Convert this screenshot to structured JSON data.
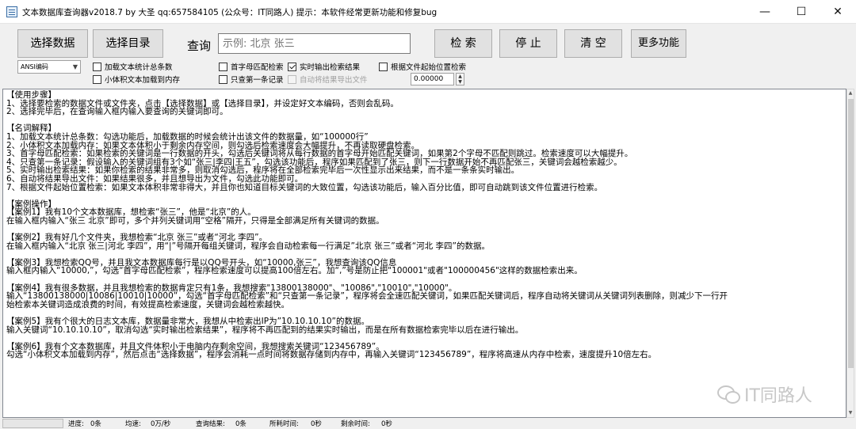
{
  "window": {
    "title": "文本数据库查询器v2018.7   by 大圣  qq:657584105  (公众号：IT同路人)  提示：本软件经常更新功能和修复bug",
    "minimize": "—",
    "maximize": "☐",
    "close": "✕"
  },
  "toolbar": {
    "select_data": "选择数据",
    "select_dir": "选择目录",
    "search_label": "查询",
    "search_placeholder": "示例: 北京 张三",
    "search_btn": "检 索",
    "stop_btn": "停 止",
    "clear_btn": "清 空",
    "more_btn": "更多功能"
  },
  "options": {
    "encoding": "ANSI编码",
    "load_count": "加载文本统计总条数",
    "small_to_memory": "小体积文本加载到内存",
    "first_letter": "首字母匹配检索",
    "realtime_output": "实时输出检索结果",
    "only_first": "只查第一条记录",
    "auto_export": "自动将结果导出文件",
    "by_position": "根据文件起始位置检索",
    "position_value": "0.00000"
  },
  "help_lines": [
    "【使用步骤】",
    "1、选择要检索的数据文件或文件夹，点击【选择数据】或【选择目录】，并设定好文本编码，否则会乱码。",
    "2、选择完毕后，在查询输入框内输入要查询的关键词即可。",
    "",
    "【名词解释】",
    "1、加载文本统计总条数：勾选功能后，加载数据的时候会统计出该文件的数据量，如“100000行”",
    "2、小体积文本加载内存：如果文本体积小于剩余内存空间，则勾选后检索速度会大幅提升，不再读取硬盘检索。",
    "3、首字母匹配检索：如果检索的关键词是一行数据的开头，勾选后关键词将从每行数据的首字母开始匹配关键词，如果第2个字母不匹配则跳过。检索速度可以大幅提升。",
    "4、只查第一条记录：假设输入的关键词组有3个如“张三|李四|王五”，勾选该功能后，程序如果匹配到了张三，则下一行数据开始不再匹配张三，关键词会越检索越少。",
    "5、实时输出检索结果：如果你检索的结果非常多，则取消勾选后，程序将在全部检索完毕后一次性显示出来结果，而不是一条条实时输出。",
    "6、自动将结果导出文件：如果结果很多，并且想导出为文件，勾选此功能即可。",
    "7、根据文件起始位置检索：如果文本体积非常非得大，并且你也知道目标关键词的大致位置，勾选该功能后，输入百分比值，即可自动跳到该文件位置进行检索。",
    "",
    "【案例操作】",
    "【案例1】我有10个文本数据库，想检索“张三”，他是“北京”的人。",
    "在输入框内输入“张三 北京”即可，多个并列关键词用“空格”隔开，只得是全部满足所有关键词的数据。",
    "",
    "【案例2】我有好几个文件夹，我想检索“北京 张三”或者“河北 李四”。",
    "在输入框内输入“北京 张三|河北 李四”，用“|”号隔开每组关键词，程序会自动检索每一行满足”北京 张三”或者“河北 李四”的数据。",
    "",
    "【案例3】我想检索QQ号，并且我文本数据库每行是以QQ号开头，如“10000,张三”，我想查询该QQ信息",
    "输入框内输入“10000,”，勾选“首字母匹配检索”，程序检索速度可以提高100倍左右。加“,”号是防止把\"100001\"或者\"100000456\"这样的数据检索出来。",
    "",
    "【案例4】我有很多数据，并且我想检索的数据肯定只有1条，我想搜索\"13800138000\"、\"10086\",\"10010\",\"10000\"。",
    "输入“13800138000|10086|10010|10000”，勾选“首字母匹配检索”和“只查第一条记录”，程序将会全速匹配关键词，如果匹配关键词后，程序自动将关键词从关键词列表删除，则减少下一行开",
    "始检索本关键词造成浪费的时间，有效提高检索速度，关键词会越检索越快。",
    "",
    "【案例5】我有个很大的日志文本库，数据量非常大，我想从中检索出IP为”10.10.10.10”的数据。",
    "输入关键词“10.10.10.10”，取消勾选“实时输出检索结果”，程序将不再匹配到的结果实时输出，而是在所有数据检索完毕以后在进行输出。",
    "",
    "【案例6】我有个文本数据库，并且文件体积小于电脑内存剩余空间，我想搜索关键词“123456789”。",
    "勾选“小体积文本加载到内存”，然后点击“选择数据”，程序会消耗一点时间将数据存储到内存中，再输入关键词“123456789”，程序将高速从内存中检索，速度提升10倍左右。"
  ],
  "watermark": "IT同路人",
  "status": {
    "progress": 0,
    "progress_label": "进度:",
    "progress_value": "0条",
    "speed_label": "均速:",
    "speed_value": "0万/秒",
    "results_label": "查询结果:",
    "results_value": "0条",
    "elapsed_label": "所耗时间:",
    "elapsed_value": "0秒",
    "remaining_label": "剩余时间:",
    "remaining_value": "0秒"
  }
}
